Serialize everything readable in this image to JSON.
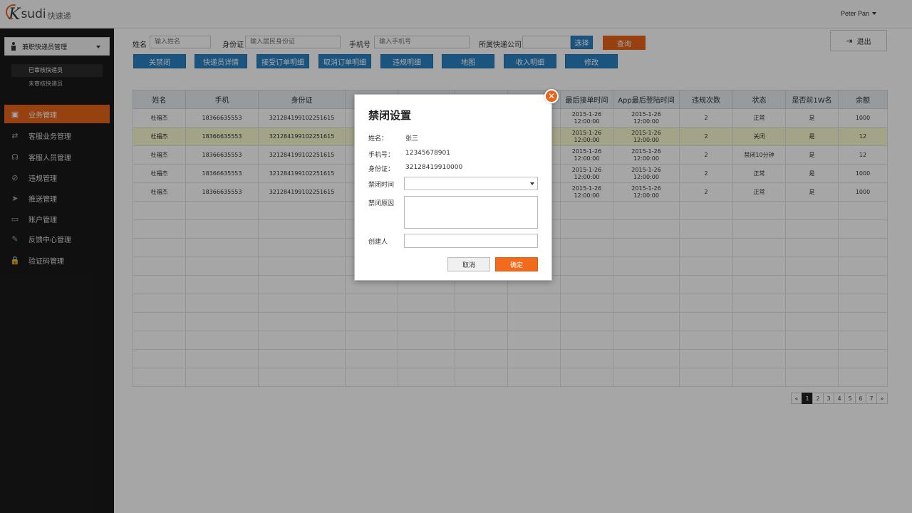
{
  "app": {
    "logo_k": "K",
    "logo_sudi": "sudi",
    "logo_cn": "快速递"
  },
  "header": {
    "user_name": "Peter Pan",
    "logout_label": "退出"
  },
  "sidebar": {
    "section_select": "兼职快递员管理",
    "sub_items": [
      {
        "label": "已审核快递员",
        "active": true
      },
      {
        "label": "未审核快递员",
        "active": false
      }
    ],
    "nav_items": [
      {
        "label": "业务管理",
        "icon": "briefcase-icon",
        "glyph": "▣",
        "active": true
      },
      {
        "label": "客服业务管理",
        "icon": "handshake-icon",
        "glyph": "⇄",
        "active": false
      },
      {
        "label": "客服人员管理",
        "icon": "headset-icon",
        "glyph": "☊",
        "active": false
      },
      {
        "label": "违规管理",
        "icon": "ban-icon",
        "glyph": "⊘",
        "active": false
      },
      {
        "label": "推送管理",
        "icon": "send-icon",
        "glyph": "➤",
        "active": false
      },
      {
        "label": "账户管理",
        "icon": "credit-card-icon",
        "glyph": "▭",
        "active": false
      },
      {
        "label": "反馈中心管理",
        "icon": "edit-icon",
        "glyph": "✎",
        "active": false
      },
      {
        "label": "验证码管理",
        "icon": "lock-icon",
        "glyph": "🔒",
        "active": false
      }
    ]
  },
  "filters": {
    "name_label": "姓名",
    "name_placeholder": "输入姓名",
    "id_label": "身份证",
    "id_placeholder": "输入居民身份证",
    "phone_label": "手机号",
    "phone_placeholder": "输入手机号",
    "company_label": "所属快递公司",
    "company_value": "",
    "select_label": "选择",
    "query_label": "查询"
  },
  "actions": [
    "关禁闭",
    "快递员详情",
    "接受订单明细",
    "取消订单明细",
    "违规明细",
    "地图",
    "收入明细",
    "修改"
  ],
  "table": {
    "headers": [
      "姓名",
      "手机",
      "身份证",
      "",
      "",
      "",
      "",
      "最后接单时间",
      "App最后登陆时间",
      "违规次数",
      "状态",
      "是否前1W名",
      "余额"
    ],
    "rows": [
      {
        "cells": [
          "杜福杰",
          "18366635553",
          "321284199102251615",
          "",
          "",
          "",
          "",
          "2015-1-26 12:00:00",
          "2015-1-26 12:00:00",
          "2",
          "正常",
          "是",
          "1000"
        ],
        "highlight": false
      },
      {
        "cells": [
          "杜福杰",
          "18366635553",
          "321284199102251615",
          "",
          "",
          "",
          "",
          "2015-1-26 12:00:00",
          "2015-1-26 12:00:00",
          "2",
          "关闭",
          "是",
          "12"
        ],
        "highlight": true
      },
      {
        "cells": [
          "杜福杰",
          "18366635553",
          "321284199102251615",
          "",
          "",
          "",
          "",
          "2015-1-26 12:00:00",
          "2015-1-26 12:00:00",
          "2",
          "禁闭10分钟",
          "是",
          "12"
        ],
        "highlight": false
      },
      {
        "cells": [
          "杜福杰",
          "18366635553",
          "321284199102251615",
          "",
          "",
          "",
          "",
          "2015-1-26 12:00:00",
          "2015-1-26 12:00:00",
          "2",
          "正常",
          "是",
          "1000"
        ],
        "highlight": false
      },
      {
        "cells": [
          "杜福杰",
          "18366635553",
          "321284199102251615",
          "",
          "",
          "",
          "",
          "2015-1-26 12:00:00",
          "2015-1-26 12:00:00",
          "2",
          "正常",
          "是",
          "1000"
        ],
        "highlight": false
      }
    ]
  },
  "pager": {
    "prev": "«",
    "pages": [
      "1",
      "2",
      "3",
      "4",
      "5",
      "6",
      "7"
    ],
    "current": "1",
    "next": "»"
  },
  "modal": {
    "title": "禁闭设置",
    "name_label": "姓名：",
    "name_value": "张三",
    "phone_label": "手机号：",
    "phone_value": "12345678901",
    "id_label": "身份证：",
    "id_value": "32128419910000",
    "ban_time_label": "禁闭时间",
    "ban_reason_label": "禁闭原因",
    "creator_label": "创建人",
    "cancel_label": "取消",
    "ok_label": "确定",
    "close_glyph": "✕"
  }
}
